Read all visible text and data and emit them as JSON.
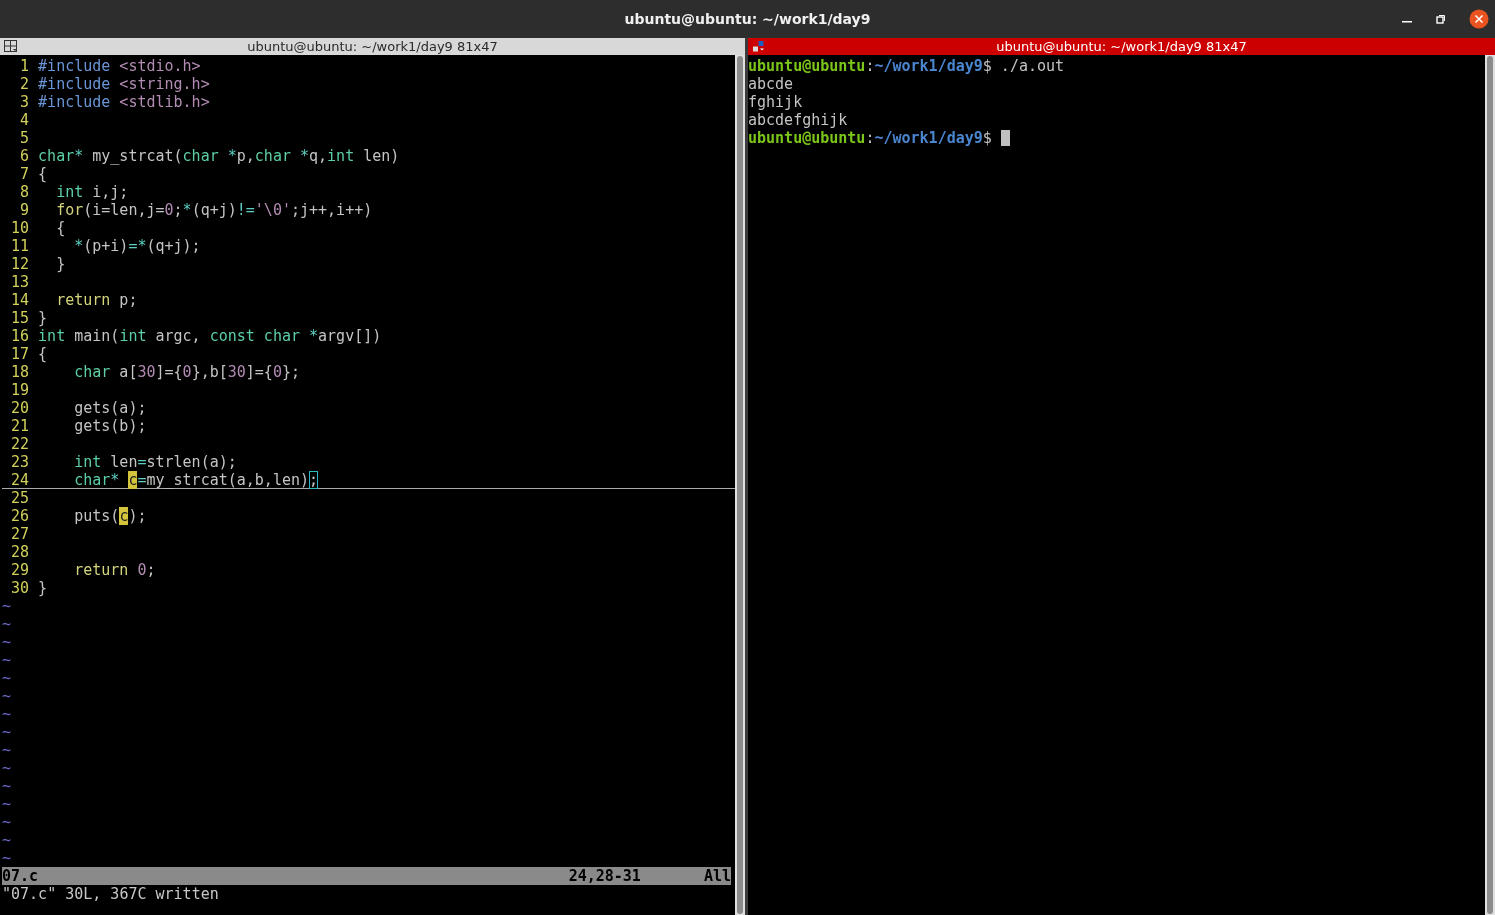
{
  "window": {
    "title": "ubuntu@ubuntu: ~/work1/day9"
  },
  "editor_pane": {
    "header": {
      "title": "ubuntu@ubuntu: ~/work1/day9 81x47",
      "focused": false
    },
    "lines": [
      {
        "number": "1",
        "cursorline": false,
        "segments": [
          {
            "text": "#include",
            "kind": "preproc"
          },
          {
            "text": " <stdio.h>",
            "kind": "string"
          }
        ]
      },
      {
        "number": "2",
        "cursorline": false,
        "segments": [
          {
            "text": "#include",
            "kind": "preproc"
          },
          {
            "text": " <string.h>",
            "kind": "string"
          }
        ]
      },
      {
        "number": "3",
        "cursorline": false,
        "segments": [
          {
            "text": "#include",
            "kind": "preproc"
          },
          {
            "text": " <stdlib.h>",
            "kind": "string"
          }
        ]
      },
      {
        "number": "4",
        "cursorline": false
      },
      {
        "number": "5",
        "cursorline": false
      },
      {
        "number": "6",
        "cursorline": false,
        "segments": [
          {
            "text": "char",
            "kind": "type"
          },
          {
            "text": "*",
            "kind": "op"
          },
          {
            "text": " my_strcat(",
            "kind": "plain"
          },
          {
            "text": "char",
            "kind": "type"
          },
          {
            "text": " *",
            "kind": "op"
          },
          {
            "text": "p,",
            "kind": "plain"
          },
          {
            "text": "char",
            "kind": "type"
          },
          {
            "text": " *",
            "kind": "op"
          },
          {
            "text": "q,",
            "kind": "plain"
          },
          {
            "text": "int",
            "kind": "type"
          },
          {
            "text": " len)",
            "kind": "plain"
          }
        ]
      },
      {
        "number": "7",
        "cursorline": false,
        "segments": [
          {
            "text": "{",
            "kind": "plain"
          }
        ]
      },
      {
        "number": "8",
        "cursorline": false,
        "segments": [
          {
            "text": "  int",
            "kind": "type"
          },
          {
            "text": " i,j;",
            "kind": "plain"
          }
        ]
      },
      {
        "number": "9",
        "cursorline": false,
        "segments": [
          {
            "text": "  for",
            "kind": "keyword"
          },
          {
            "text": "(i=len,j=",
            "kind": "plain"
          },
          {
            "text": "0",
            "kind": "number"
          },
          {
            "text": ";",
            "kind": "plain"
          },
          {
            "text": "*",
            "kind": "op"
          },
          {
            "text": "(q+j)",
            "kind": "plain"
          },
          {
            "text": "!=",
            "kind": "op"
          },
          {
            "text": "'\\0'",
            "kind": "string"
          },
          {
            "text": ";j++,i++)",
            "kind": "plain"
          }
        ]
      },
      {
        "number": "10",
        "cursorline": false,
        "segments": [
          {
            "text": "  {",
            "kind": "plain"
          }
        ]
      },
      {
        "number": "11",
        "cursorline": false,
        "segments": [
          {
            "text": "    *",
            "kind": "op"
          },
          {
            "text": "(p+i)",
            "kind": "plain"
          },
          {
            "text": "=*",
            "kind": "op"
          },
          {
            "text": "(q+j);",
            "kind": "plain"
          }
        ]
      },
      {
        "number": "12",
        "cursorline": false,
        "segments": [
          {
            "text": "  }",
            "kind": "plain"
          }
        ]
      },
      {
        "number": "13",
        "cursorline": false
      },
      {
        "number": "14",
        "cursorline": false,
        "segments": [
          {
            "text": "  return",
            "kind": "keyword"
          },
          {
            "text": " p;",
            "kind": "plain"
          }
        ]
      },
      {
        "number": "15",
        "cursorline": false,
        "segments": [
          {
            "text": "}",
            "kind": "plain"
          }
        ]
      },
      {
        "number": "16",
        "cursorline": false,
        "segments": [
          {
            "text": "int",
            "kind": "type"
          },
          {
            "text": " main(",
            "kind": "plain"
          },
          {
            "text": "int",
            "kind": "type"
          },
          {
            "text": " argc, ",
            "kind": "plain"
          },
          {
            "text": "const",
            "kind": "type"
          },
          {
            "text": " char",
            "kind": "type"
          },
          {
            "text": " *",
            "kind": "op"
          },
          {
            "text": "argv[])",
            "kind": "plain"
          }
        ]
      },
      {
        "number": "17",
        "cursorline": false,
        "segments": [
          {
            "text": "{",
            "kind": "plain"
          }
        ]
      },
      {
        "number": "18",
        "cursorline": false,
        "segments": [
          {
            "text": "    char",
            "kind": "type"
          },
          {
            "text": " a[",
            "kind": "plain"
          },
          {
            "text": "30",
            "kind": "number"
          },
          {
            "text": "]={",
            "kind": "plain"
          },
          {
            "text": "0",
            "kind": "number"
          },
          {
            "text": "},b[",
            "kind": "plain"
          },
          {
            "text": "30",
            "kind": "number"
          },
          {
            "text": "]={",
            "kind": "plain"
          },
          {
            "text": "0",
            "kind": "number"
          },
          {
            "text": "};",
            "kind": "plain"
          }
        ]
      },
      {
        "number": "19",
        "cursorline": false
      },
      {
        "number": "20",
        "cursorline": false,
        "segments": [
          {
            "text": "    gets(a);",
            "kind": "plain"
          }
        ]
      },
      {
        "number": "21",
        "cursorline": false,
        "segments": [
          {
            "text": "    gets(b);",
            "kind": "plain"
          }
        ]
      },
      {
        "number": "22",
        "cursorline": false
      },
      {
        "number": "23",
        "cursorline": false,
        "segments": [
          {
            "text": "    int",
            "kind": "type"
          },
          {
            "text": " len",
            "kind": "plain"
          },
          {
            "text": "=",
            "kind": "op"
          },
          {
            "text": "strlen(a);",
            "kind": "plain"
          }
        ]
      },
      {
        "number": "24",
        "cursorline": true,
        "segments": [
          {
            "text": "    char",
            "kind": "type"
          },
          {
            "text": "* ",
            "kind": "op"
          },
          {
            "text": "c",
            "kind": "search"
          },
          {
            "text": "=",
            "kind": "op"
          },
          {
            "text": "my_strcat(a,b,len)",
            "kind": "plain"
          },
          {
            "text": ";",
            "kind": "match"
          }
        ]
      },
      {
        "number": "25",
        "cursorline": false
      },
      {
        "number": "26",
        "cursorline": false,
        "segments": [
          {
            "text": "    puts(",
            "kind": "plain"
          },
          {
            "text": "c",
            "kind": "search"
          },
          {
            "text": ");",
            "kind": "plain"
          }
        ]
      },
      {
        "number": "27",
        "cursorline": false
      },
      {
        "number": "28",
        "cursorline": false
      },
      {
        "number": "29",
        "cursorline": false,
        "segments": [
          {
            "text": "    return",
            "kind": "keyword"
          },
          {
            "text": " 0",
            "kind": "number"
          },
          {
            "text": ";",
            "kind": "plain"
          }
        ]
      },
      {
        "number": "30",
        "cursorline": false,
        "segments": [
          {
            "text": "}",
            "kind": "plain"
          }
        ]
      }
    ],
    "filler": [
      "~",
      "~",
      "~",
      "~",
      "~",
      "~",
      "~",
      "~",
      "~",
      "~",
      "~",
      "~",
      "~",
      "~",
      "~"
    ],
    "status_line": {
      "file": "07.c",
      "position": "24,28-31",
      "scroll": "All"
    },
    "message": "\"07.c\" 30L, 367C written"
  },
  "terminal_pane": {
    "header": {
      "title": "ubuntu@ubuntu: ~/work1/day9 81x47",
      "focused": true
    },
    "lines": [
      {
        "segments": [
          {
            "text": "ubuntu@ubuntu",
            "kind": "user"
          },
          {
            "text": ":",
            "kind": "plain"
          },
          {
            "text": "~/work1/day9",
            "kind": "path"
          },
          {
            "text": "$ ./a.out",
            "kind": "plain"
          }
        ]
      },
      {
        "segments": [
          {
            "text": "abcde",
            "kind": "plain"
          }
        ]
      },
      {
        "segments": [
          {
            "text": "fghijk",
            "kind": "plain"
          }
        ]
      },
      {
        "segments": [
          {
            "text": "abcdefghijk",
            "kind": "plain"
          }
        ]
      },
      {
        "segments": [
          {
            "text": "ubuntu@ubuntu",
            "kind": "user"
          },
          {
            "text": ":",
            "kind": "plain"
          },
          {
            "text": "~/work1/day9",
            "kind": "path"
          },
          {
            "text": "$ ",
            "kind": "plain"
          }
        ],
        "cursor": true
      }
    ]
  }
}
